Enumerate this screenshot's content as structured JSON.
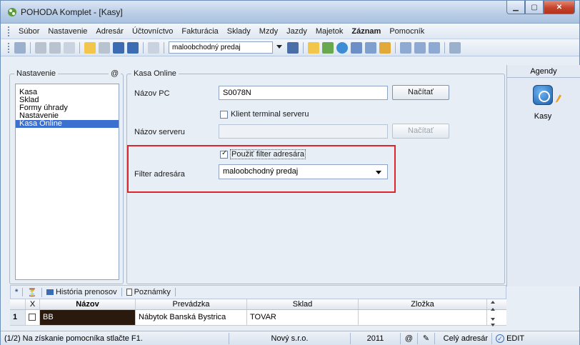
{
  "window": {
    "title": "POHODA Komplet - [Kasy]"
  },
  "menu": [
    "Súbor",
    "Nastavenie",
    "Adresár",
    "Účtovníctvo",
    "Fakturácia",
    "Sklady",
    "Mzdy",
    "Jazdy",
    "Majetok",
    "Záznam",
    "Pomocník"
  ],
  "toolbar": {
    "filter_value": "maloobchodný predaj"
  },
  "left": {
    "legend": "Nastavenie",
    "legend_icon": "@",
    "items": [
      "Kasa",
      "Sklad",
      "Formy úhrady",
      "Nastavenie",
      "Kasa Online"
    ],
    "selected": 4
  },
  "kasa_online": {
    "legend": "Kasa Online",
    "pc_label": "Názov PC",
    "pc_value": "S0078N",
    "load_label": "Načítať",
    "terminal_label": "Klient terminal serveru",
    "server_label": "Názov serveru",
    "server_value": "",
    "load2_label": "Načítať",
    "use_filter_label": "Použiť filter adresára",
    "filter_label": "Filter adresára",
    "filter_value": "maloobchodný predaj"
  },
  "agendy": {
    "title": "Agendy",
    "item_label": "Kasy"
  },
  "tabs": {
    "asterisk": "*",
    "history": "História prenosov",
    "notes": "Poznámky"
  },
  "grid": {
    "headers": [
      "X",
      "Názov",
      "Prevádzka",
      "Sklad",
      "Zložka"
    ],
    "row": {
      "num": "1",
      "name": "BB",
      "prevadzka": "Nábytok Banská Bystrica",
      "sklad": "TOVAR",
      "zlozka": ""
    }
  },
  "status": {
    "help": "(1/2) Na získanie pomocníka stlačte F1.",
    "company": "Nový s.r.o.",
    "year": "2011",
    "at": "@",
    "address": "Celý adresár",
    "mode": "EDIT"
  }
}
